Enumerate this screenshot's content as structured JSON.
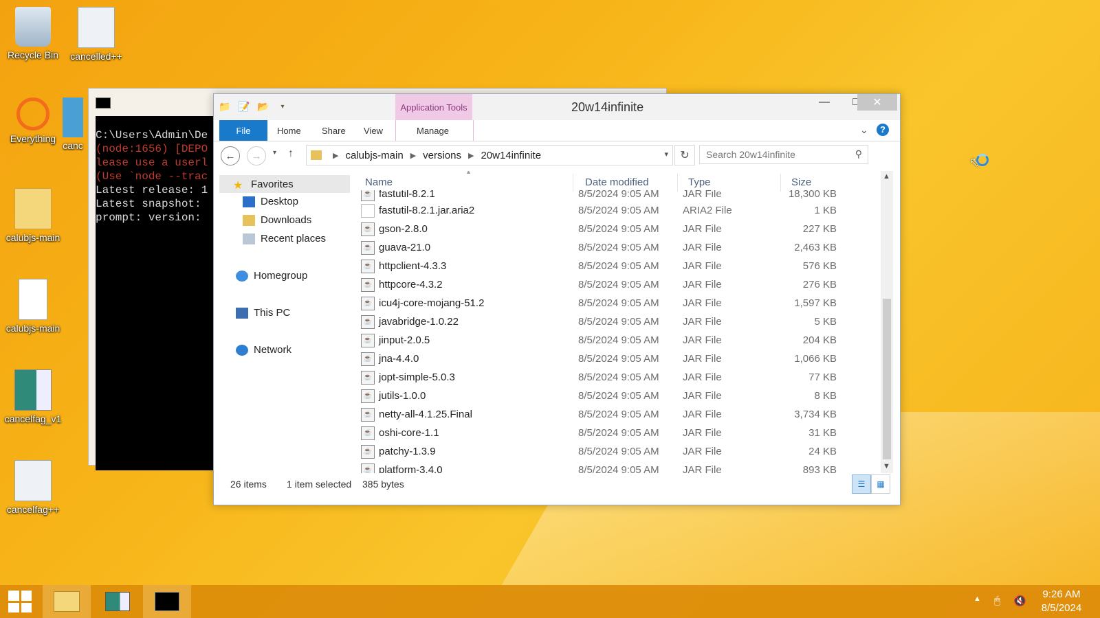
{
  "desktop": {
    "icons": [
      {
        "label": "Recycle Bin"
      },
      {
        "label": "cancelled++"
      },
      {
        "label": "Everything"
      },
      {
        "label": "canc"
      },
      {
        "label": "calubjs-main"
      },
      {
        "label": "calubjs-main"
      },
      {
        "label": "cancelfag_v1"
      },
      {
        "label": "cancelfag++"
      }
    ]
  },
  "console": {
    "lines": [
      "C:\\Users\\Admin\\De",
      "(node:1656) [DEPO",
      "lease use a userl",
      "(Use `node --trac",
      "Latest release: 1",
      "Latest snapshot:",
      "prompt: version:"
    ]
  },
  "explorer": {
    "title": "20w14infinite",
    "app_tools": "Application Tools",
    "tabs": {
      "file": "File",
      "home": "Home",
      "share": "Share",
      "view": "View",
      "manage": "Manage"
    },
    "breadcrumb": [
      "calubjs-main",
      "versions",
      "20w14infinite"
    ],
    "search_placeholder": "Search 20w14infinite",
    "nav": {
      "favorites": "Favorites",
      "desktop": "Desktop",
      "downloads": "Downloads",
      "recent": "Recent places",
      "homegroup": "Homegroup",
      "thispc": "This PC",
      "network": "Network"
    },
    "columns": {
      "name": "Name",
      "date": "Date modified",
      "type": "Type",
      "size": "Size"
    },
    "partial_row": {
      "name": "fastutil-8.2.1",
      "date": "8/5/2024 9:05 AM",
      "type": "JAR File",
      "size": "18,300 KB"
    },
    "files": [
      {
        "name": "fastutil-8.2.1.jar.aria2",
        "date": "8/5/2024 9:05 AM",
        "type": "ARIA2 File",
        "size": "1 KB"
      },
      {
        "name": "gson-2.8.0",
        "date": "8/5/2024 9:05 AM",
        "type": "JAR File",
        "size": "227 KB"
      },
      {
        "name": "guava-21.0",
        "date": "8/5/2024 9:05 AM",
        "type": "JAR File",
        "size": "2,463 KB"
      },
      {
        "name": "httpclient-4.3.3",
        "date": "8/5/2024 9:05 AM",
        "type": "JAR File",
        "size": "576 KB"
      },
      {
        "name": "httpcore-4.3.2",
        "date": "8/5/2024 9:05 AM",
        "type": "JAR File",
        "size": "276 KB"
      },
      {
        "name": "icu4j-core-mojang-51.2",
        "date": "8/5/2024 9:05 AM",
        "type": "JAR File",
        "size": "1,597 KB"
      },
      {
        "name": "javabridge-1.0.22",
        "date": "8/5/2024 9:05 AM",
        "type": "JAR File",
        "size": "5 KB"
      },
      {
        "name": "jinput-2.0.5",
        "date": "8/5/2024 9:05 AM",
        "type": "JAR File",
        "size": "204 KB"
      },
      {
        "name": "jna-4.4.0",
        "date": "8/5/2024 9:05 AM",
        "type": "JAR File",
        "size": "1,066 KB"
      },
      {
        "name": "jopt-simple-5.0.3",
        "date": "8/5/2024 9:05 AM",
        "type": "JAR File",
        "size": "77 KB"
      },
      {
        "name": "jutils-1.0.0",
        "date": "8/5/2024 9:05 AM",
        "type": "JAR File",
        "size": "8 KB"
      },
      {
        "name": "netty-all-4.1.25.Final",
        "date": "8/5/2024 9:05 AM",
        "type": "JAR File",
        "size": "3,734 KB"
      },
      {
        "name": "oshi-core-1.1",
        "date": "8/5/2024 9:05 AM",
        "type": "JAR File",
        "size": "31 KB"
      },
      {
        "name": "patchy-1.3.9",
        "date": "8/5/2024 9:05 AM",
        "type": "JAR File",
        "size": "24 KB"
      },
      {
        "name": "platform-3.4.0",
        "date": "8/5/2024 9:05 AM",
        "type": "JAR File",
        "size": "893 KB"
      }
    ],
    "status": {
      "count": "26 items",
      "selected": "1 item selected",
      "size": "385 bytes"
    }
  },
  "taskbar": {
    "time": "9:26 AM",
    "date": "8/5/2024"
  }
}
